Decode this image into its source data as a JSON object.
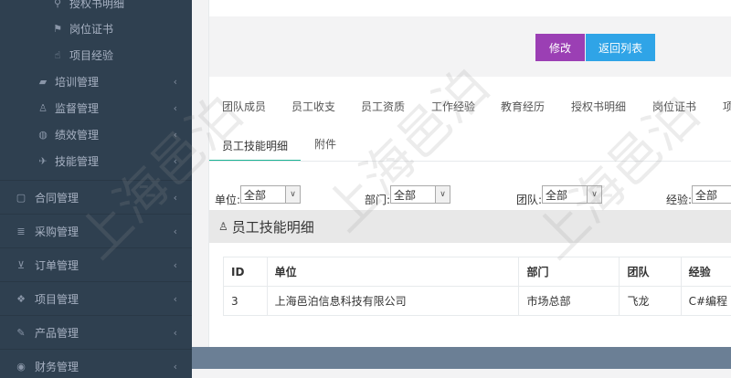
{
  "sidebar": {
    "items": [
      {
        "label": "授权书明细",
        "icon": "key-icon",
        "level": 3
      },
      {
        "label": "岗位证书",
        "icon": "flag-icon",
        "level": 3
      },
      {
        "label": "项目经验",
        "icon": "hand-icon",
        "level": 3
      },
      {
        "label": "培训管理",
        "icon": "briefcase-icon",
        "level": 2
      },
      {
        "label": "监督管理",
        "icon": "user-tie-icon",
        "level": 2
      },
      {
        "label": "绩效管理",
        "icon": "globe-icon",
        "level": 2
      },
      {
        "label": "技能管理",
        "icon": "plane-icon",
        "level": 2
      },
      {
        "label": "合同管理",
        "icon": "document-icon",
        "level": 1
      },
      {
        "label": "采购管理",
        "icon": "list-icon",
        "level": 1
      },
      {
        "label": "订单管理",
        "icon": "cart-icon",
        "level": 1
      },
      {
        "label": "项目管理",
        "icon": "cubes-icon",
        "level": 1
      },
      {
        "label": "产品管理",
        "icon": "edit-icon",
        "level": 1
      },
      {
        "label": "财务管理",
        "icon": "money-icon",
        "level": 1
      }
    ],
    "chevron": "‹"
  },
  "toolbar": {
    "edit_label": "修改",
    "back_label": "返回列表"
  },
  "tabs": [
    {
      "label": "团队成员"
    },
    {
      "label": "员工收支"
    },
    {
      "label": "员工资质"
    },
    {
      "label": "工作经验"
    },
    {
      "label": "教育经历"
    },
    {
      "label": "授权书明细"
    },
    {
      "label": "岗位证书"
    },
    {
      "label": "项"
    },
    {
      "label": "员工技能明细"
    },
    {
      "label": "附件"
    }
  ],
  "filters": [
    {
      "label": "单位:",
      "value": "全部"
    },
    {
      "label": "部门:",
      "value": "全部"
    },
    {
      "label": "团队:",
      "value": "全部"
    },
    {
      "label": "经验:",
      "value": "全部"
    }
  ],
  "section": {
    "title": "员工技能明细",
    "icon": "user-icon"
  },
  "table": {
    "columns": [
      "ID",
      "单位",
      "部门",
      "团队",
      "经验"
    ],
    "rows": [
      [
        "3",
        "上海邑泊信息科技有限公司",
        "市场总部",
        "飞龙",
        "C#编程"
      ]
    ]
  },
  "watermark": "上海邑泊"
}
